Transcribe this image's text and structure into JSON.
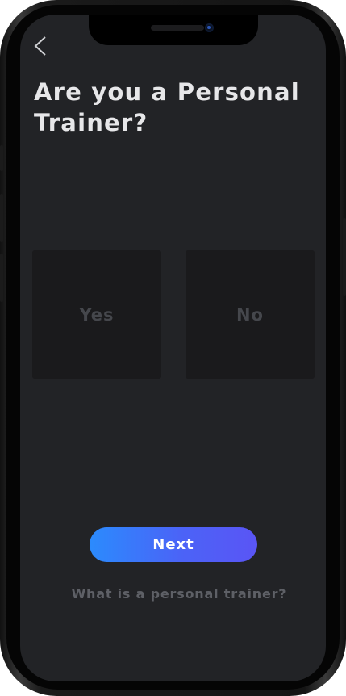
{
  "header": {
    "back_icon": "chevron-left-icon"
  },
  "question": {
    "title": "Are you a Personal Trainer?"
  },
  "options": [
    {
      "label": "Yes"
    },
    {
      "label": "No"
    }
  ],
  "actions": {
    "next_label": "Next",
    "help_link": "What is a personal trainer?"
  },
  "colors": {
    "background": "#222326",
    "option_tile": "#1a1a1c",
    "title_text": "#e7e7e9",
    "option_text": "#45474c",
    "button_gradient_start": "#2b8bfd",
    "button_gradient_end": "#5a55f5",
    "link_text": "#5e6066"
  }
}
